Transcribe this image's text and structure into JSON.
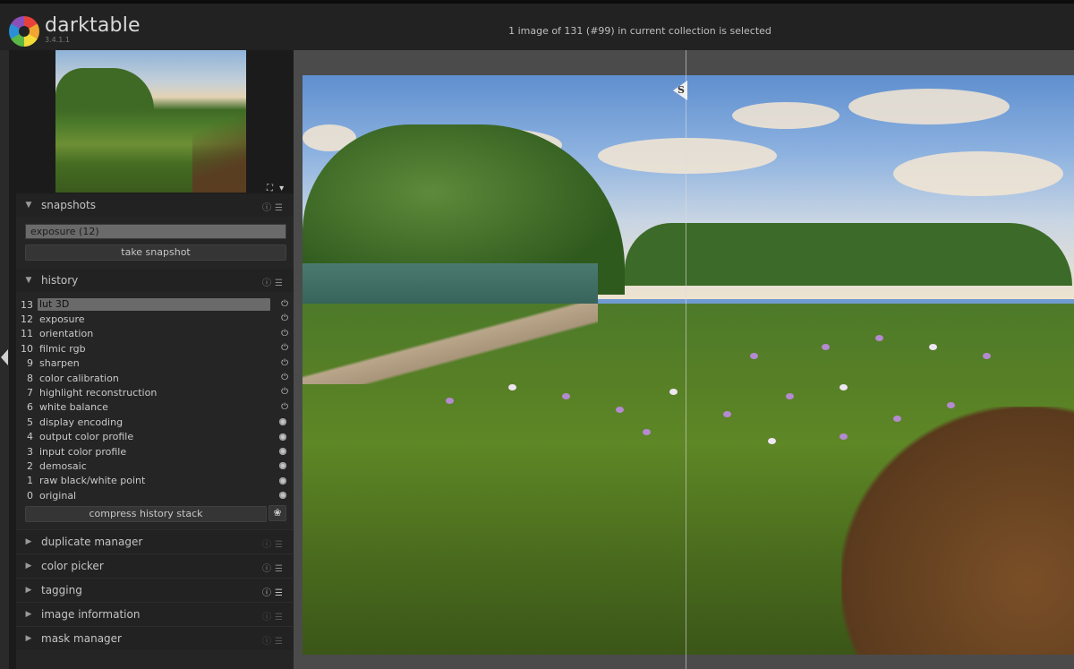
{
  "app": {
    "name": "darktable",
    "version": "3.4.1.1",
    "status": "1 image of 131 (#99) in current collection is selected"
  },
  "navigator": {
    "icons": "⛶ ▾"
  },
  "snapshots": {
    "title": "snapshots",
    "snapshot_value": "exposure (12)",
    "take_label": "take snapshot"
  },
  "history": {
    "title": "history",
    "items": [
      {
        "num": "13",
        "label": "lut 3D",
        "state": "power",
        "selected": true
      },
      {
        "num": "12",
        "label": "exposure",
        "state": "power"
      },
      {
        "num": "11",
        "label": "orientation",
        "state": "power"
      },
      {
        "num": "10",
        "label": "filmic rgb",
        "state": "power"
      },
      {
        "num": "9",
        "label": "sharpen",
        "state": "power"
      },
      {
        "num": "8",
        "label": "color calibration",
        "state": "power"
      },
      {
        "num": "7",
        "label": "highlight reconstruction",
        "state": "power"
      },
      {
        "num": "6",
        "label": "white balance",
        "state": "power"
      },
      {
        "num": "5",
        "label": "display encoding",
        "state": "dot"
      },
      {
        "num": "4",
        "label": "output color profile",
        "state": "dot"
      },
      {
        "num": "3",
        "label": "input color profile",
        "state": "dot"
      },
      {
        "num": "2",
        "label": "demosaic",
        "state": "dot"
      },
      {
        "num": "1",
        "label": "raw black/white point",
        "state": "dot"
      },
      {
        "num": "0",
        "label": "original",
        "state": "dot"
      }
    ],
    "compress_label": "compress history stack"
  },
  "modules": [
    {
      "title": "duplicate manager",
      "icons_dim": true
    },
    {
      "title": "color picker",
      "icons_dim": false
    },
    {
      "title": "tagging",
      "icons_dim": false
    },
    {
      "title": "image information",
      "icons_dim": true
    },
    {
      "title": "mask manager",
      "icons_dim": true
    }
  ],
  "viewer": {
    "snapshot_marker": "S"
  },
  "icons": {
    "collapse": "triangle-down-icon",
    "expand": "triangle-right-icon",
    "reset": "reset-icon",
    "presets": "presets-icon",
    "power": "power-icon",
    "always_on": "always-on-icon"
  }
}
